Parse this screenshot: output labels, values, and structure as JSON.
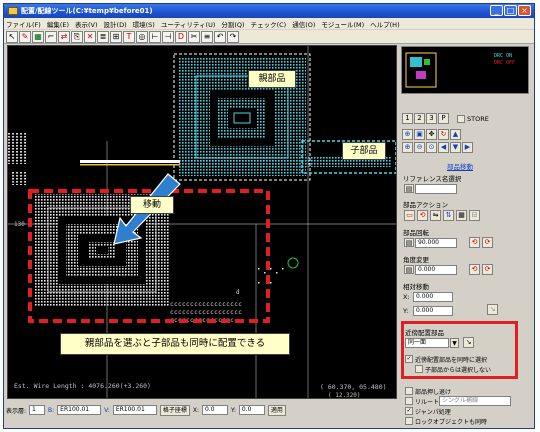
{
  "window": {
    "title": "配置/配線ツール(C:¥temp¥before01)"
  },
  "menu": [
    "ファイル(F)",
    "編集(E)",
    "表示(V)",
    "設計(D)",
    "環境(S)",
    "ユーティリティ(U)",
    "分割(Q)",
    "チェック(C)",
    "通信(O)",
    "モジュール(M)",
    "ヘルプ(H)"
  ],
  "canvas": {
    "wire_length": "Est. Wire Length : 4076.260(+3.260)",
    "coords": "( 60.370, 05.480)",
    "coords2": "( 12.320)",
    "label_130": "130",
    "label_d": "d"
  },
  "annotations": {
    "parent_part": "親部品",
    "child_part": "子部品",
    "move": "移動",
    "caption": "親部品を選ぶと子部品も同時に配置できる"
  },
  "minimap": {
    "legend_on": "DRC ON",
    "legend_off": "DRC OFF"
  },
  "panel": {
    "view_buttons": [
      "1",
      "2",
      "3",
      "P"
    ],
    "store_label": "STORE",
    "section_title": "部品移動",
    "reference_label": "リファレンス名選択",
    "part_action_label": "部品アクション",
    "rotation_label": "部品回転",
    "rotation_value": "90.000",
    "angle_label": "角度変更",
    "angle_value": "0.000",
    "relative_move_label": "相対移動",
    "x_label": "X:",
    "x_value": "0.000",
    "y_label": "Y:",
    "y_value": "0.000",
    "placement_label": "近傍配置部品",
    "placement_select": "同一面",
    "check_select_nearby": "近傍配置部品を同時に選択",
    "check_child_not_select": "子部品からは選択しない",
    "check_push": "部品押し退け",
    "check_leave_label": "リルート",
    "check_leave_value": "シングル補線",
    "check_jumper": "ジャンパ処理",
    "check_last": "ロックオブジェクトも同時"
  },
  "status": {
    "layer_label": "表示層:",
    "layer_value": "1",
    "b_label": "B:",
    "b_value": "ER100.01",
    "v_label": "V:",
    "v_value": "ER100.01",
    "grid_label": "格子座標",
    "x_label": "X:",
    "x_value": "0.0",
    "y_label": "Y:",
    "y_value": "0.0",
    "apply": "適用"
  },
  "colors": {
    "highlight_red": "#e02020",
    "selection_cyan": "#4fd6e6",
    "component_white": "#e8e8e8",
    "via_green": "#30c030"
  }
}
